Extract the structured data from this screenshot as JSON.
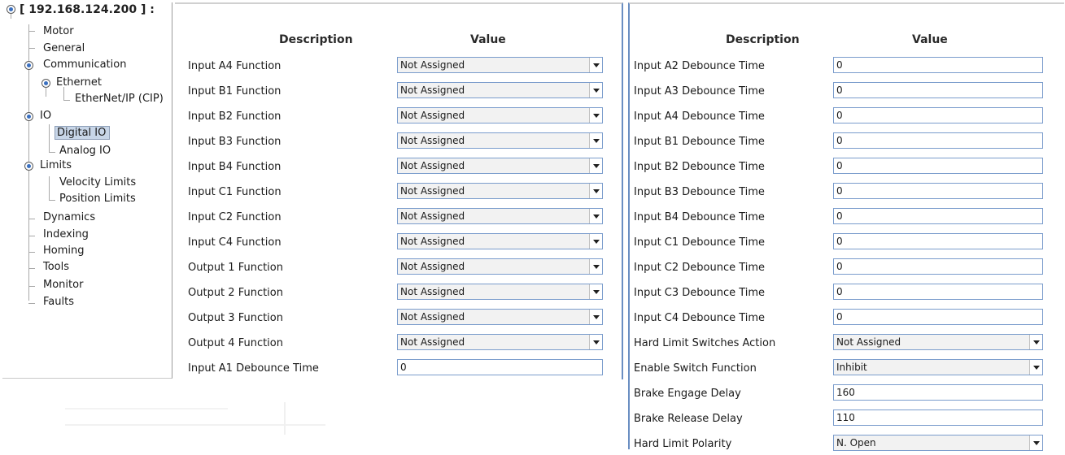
{
  "tree": {
    "root_label": "[ 192.168.124.200 ] :",
    "items": [
      {
        "label": "Motor"
      },
      {
        "label": "General"
      },
      {
        "label": "Communication"
      },
      {
        "label": "Ethernet"
      },
      {
        "label": "EtherNet/IP (CIP)"
      },
      {
        "label": "IO"
      },
      {
        "label": "Digital IO",
        "selected": true
      },
      {
        "label": "Analog IO"
      },
      {
        "label": "Limits"
      },
      {
        "label": "Velocity Limits"
      },
      {
        "label": "Position Limits"
      },
      {
        "label": "Dynamics"
      },
      {
        "label": "Indexing"
      },
      {
        "label": "Homing"
      },
      {
        "label": "Tools"
      },
      {
        "label": "Monitor"
      },
      {
        "label": "Faults"
      }
    ]
  },
  "panel_left": {
    "header": {
      "description": "Description",
      "value": "Value"
    },
    "rows": [
      {
        "label": "Input A4 Function",
        "value": "Not Assigned",
        "type": "dropdown"
      },
      {
        "label": "Input B1 Function",
        "value": "Not Assigned",
        "type": "dropdown"
      },
      {
        "label": "Input B2 Function",
        "value": "Not Assigned",
        "type": "dropdown"
      },
      {
        "label": "Input B3 Function",
        "value": "Not Assigned",
        "type": "dropdown"
      },
      {
        "label": "Input B4 Function",
        "value": "Not Assigned",
        "type": "dropdown"
      },
      {
        "label": "Input C1 Function",
        "value": "Not Assigned",
        "type": "dropdown"
      },
      {
        "label": "Input C2 Function",
        "value": "Not Assigned",
        "type": "dropdown"
      },
      {
        "label": "Input C4 Function",
        "value": "Not Assigned",
        "type": "dropdown"
      },
      {
        "label": "Output 1 Function",
        "value": "Not Assigned",
        "type": "dropdown"
      },
      {
        "label": "Output 2 Function",
        "value": "Not Assigned",
        "type": "dropdown"
      },
      {
        "label": "Output 3 Function",
        "value": "Not Assigned",
        "type": "dropdown"
      },
      {
        "label": "Output 4 Function",
        "value": "Not Assigned",
        "type": "dropdown"
      },
      {
        "label": "Input A1 Debounce Time",
        "value": "0",
        "type": "text"
      }
    ]
  },
  "panel_right": {
    "header": {
      "description": "Description",
      "value": "Value"
    },
    "rows": [
      {
        "label": "Input A2 Debounce Time",
        "value": "0",
        "type": "text"
      },
      {
        "label": "Input A3 Debounce Time",
        "value": "0",
        "type": "text"
      },
      {
        "label": "Input A4 Debounce Time",
        "value": "0",
        "type": "text"
      },
      {
        "label": "Input B1 Debounce Time",
        "value": "0",
        "type": "text"
      },
      {
        "label": "Input B2 Debounce Time",
        "value": "0",
        "type": "text"
      },
      {
        "label": "Input B3 Debounce Time",
        "value": "0",
        "type": "text"
      },
      {
        "label": "Input B4 Debounce Time",
        "value": "0",
        "type": "text"
      },
      {
        "label": "Input C1 Debounce Time",
        "value": "0",
        "type": "text"
      },
      {
        "label": "Input C2 Debounce Time",
        "value": "0",
        "type": "text"
      },
      {
        "label": "Input C3 Debounce Time",
        "value": "0",
        "type": "text"
      },
      {
        "label": "Input C4 Debounce Time",
        "value": "0",
        "type": "text"
      },
      {
        "label": "Hard Limit Switches Action",
        "value": "Not Assigned",
        "type": "dropdown"
      },
      {
        "label": "Enable Switch Function",
        "value": "Inhibit",
        "type": "dropdown"
      },
      {
        "label": "Brake Engage Delay",
        "value": "160",
        "type": "text"
      },
      {
        "label": "Brake Release Delay",
        "value": "110",
        "type": "text"
      },
      {
        "label": "Hard Limit Polarity",
        "value": "N. Open",
        "type": "dropdown"
      }
    ]
  },
  "colors": {
    "input_border": "#7a9ccc",
    "selection": "#c8d6e8",
    "panel_border": "#6a8ec2"
  }
}
